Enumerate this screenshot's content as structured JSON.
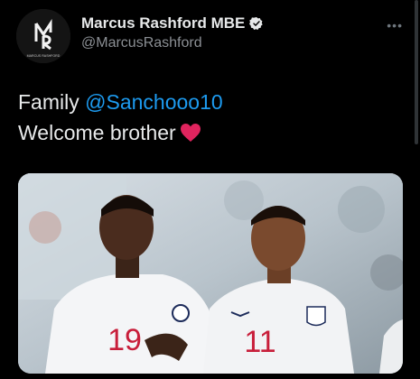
{
  "tweet": {
    "author": {
      "display_name": "Marcus Rashford MBE",
      "handle": "@MarcusRashford",
      "avatar_text": "MARCUS RASHFORD",
      "verified": true
    },
    "more_icon": "more-dots-icon",
    "text_line1_prefix": "Family ",
    "mention": "@Sanchooo10",
    "text_line2": "Welcome brother",
    "emoji": "red-heart",
    "media": {
      "description_icon": "photo",
      "left_shirt_number": "19",
      "right_shirt_number": "11"
    }
  },
  "colors": {
    "background": "#000000",
    "mention": "#1d9bf0",
    "handle": "#8b8f94",
    "heart": "#e0245e"
  }
}
